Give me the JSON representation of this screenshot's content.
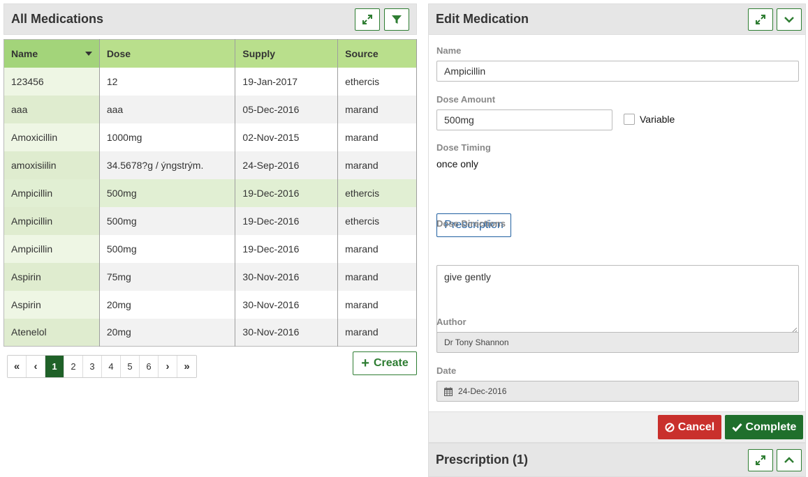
{
  "list_panel": {
    "title": "All Medications",
    "expand_icon": "expand-arrows-icon",
    "filter_icon": "filter-funnel-icon"
  },
  "table": {
    "columns": [
      "Name",
      "Dose",
      "Supply",
      "Source"
    ],
    "sorted_column": "Name",
    "rows": [
      [
        "123456",
        "12",
        "19-Jan-2017",
        "ethercis"
      ],
      [
        "aaa",
        "aaa",
        "05-Dec-2016",
        "marand"
      ],
      [
        "Amoxicillin",
        "1000mg",
        "02-Nov-2015",
        "marand"
      ],
      [
        "amoxisiilin",
        "34.5678?g / ýngstrým.",
        "24-Sep-2016",
        "marand"
      ],
      [
        "Ampicillin",
        "500mg",
        "19-Dec-2016",
        "ethercis"
      ],
      [
        "Ampicillin",
        "500mg",
        "19-Dec-2016",
        "ethercis"
      ],
      [
        "Ampicillin",
        "500mg",
        "19-Dec-2016",
        "marand"
      ],
      [
        "Aspirin",
        "75mg",
        "30-Nov-2016",
        "marand"
      ],
      [
        "Aspirin",
        "20mg",
        "30-Nov-2016",
        "marand"
      ],
      [
        "Atenelol",
        "20mg",
        "30-Nov-2016",
        "marand"
      ]
    ],
    "selected_row_index": 4
  },
  "pager": {
    "first": "«",
    "prev": "‹",
    "pages": [
      "1",
      "2",
      "3",
      "4",
      "5",
      "6"
    ],
    "active_page": "1",
    "next": "›",
    "last": "»"
  },
  "create_button": {
    "label": "Create"
  },
  "edit_panel": {
    "title": "Edit Medication",
    "name_label": "Name",
    "name_value": "Ampicillin",
    "dose_amount_label": "Dose Amount",
    "dose_amount_value": "500mg",
    "variable_label": "Variable",
    "variable_checked": false,
    "dose_timing_label": "Dose Timing",
    "dose_timing_value": "once only",
    "prescription_button": "Prescription",
    "dose_directions_label": "Dose Directions",
    "dose_directions_value": "give gently",
    "author_label": "Author",
    "author_value": "Dr Tony Shannon",
    "date_label": "Date",
    "date_value": "24-Dec-2016",
    "cancel_label": "Cancel",
    "complete_label": "Complete"
  },
  "prescription_panel": {
    "title": "Prescription (1)"
  },
  "colors": {
    "header_green": "#b9df8c",
    "accent_green": "#2e7d32",
    "cancel_red": "#c9302c",
    "complete_green": "#1f6f2c",
    "link_blue": "#1f5fa0"
  }
}
